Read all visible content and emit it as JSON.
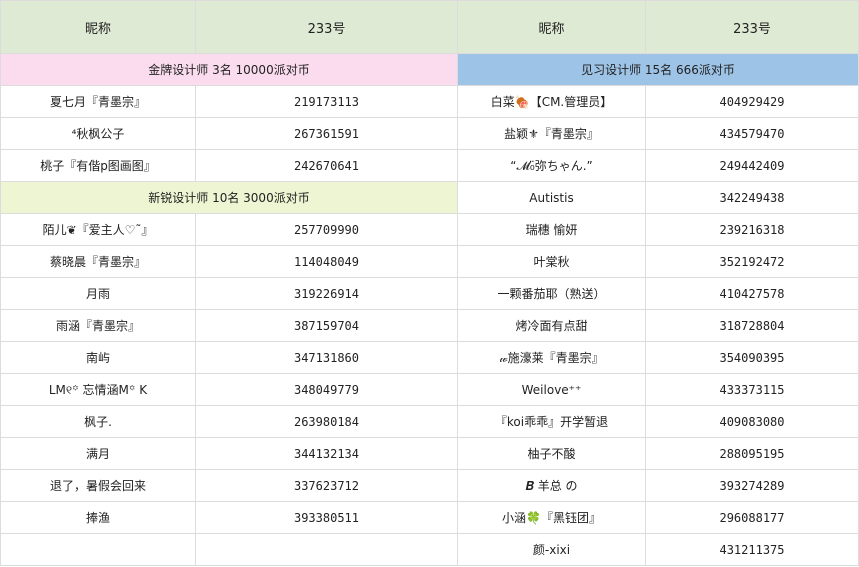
{
  "header": {
    "left_name": "昵称",
    "left_id": "233号",
    "right_name": "昵称",
    "right_id": "233号"
  },
  "sections": {
    "gold": "金牌设计师 3名 10000派对币",
    "intern": "见习设计师 15名 666派对币",
    "newbie": "新锐设计师 10名 3000派对币"
  },
  "left": {
    "gold": [
      {
        "name": "夏七月『青墨宗』",
        "id": "219173113"
      },
      {
        "name": "⁴秋枫公子",
        "id": "267361591"
      },
      {
        "name": "桃子『有偕p图画图』",
        "id": "242670641"
      }
    ],
    "newbie": [
      {
        "name": "陌儿❦『爱主人♡˜』",
        "id": "257709990"
      },
      {
        "name": "蔡晓晨『青墨宗』",
        "id": "114048049"
      },
      {
        "name": "月雨",
        "id": "319226914"
      },
      {
        "name": "雨涵『青墨宗』",
        "id": "387159704"
      },
      {
        "name": "南屿",
        "id": "347131860"
      },
      {
        "name": "LM୧꙳ 忘情涵M꙳ K",
        "id": "348049779"
      },
      {
        "name": "枫子.",
        "id": "263980184"
      },
      {
        "name": "满月",
        "id": "344132134"
      },
      {
        "name": "退了，暑假会回来",
        "id": "337623712"
      },
      {
        "name": "捧渔",
        "id": "393380511"
      },
      {
        "name": "",
        "id": ""
      }
    ]
  },
  "right": [
    {
      "name": "白菜🍖【CM.管理员】",
      "id": "404929429"
    },
    {
      "name": "盐颖⚜『青墨宗』",
      "id": "434579470"
    },
    {
      "name": "“𝓜₀̈弥ちゃん.”",
      "id": "249442409"
    },
    {
      "name": "Autistis",
      "id": "342249438"
    },
    {
      "name": "瑞穗 愉妍",
      "id": "239216318"
    },
    {
      "name": "叶棠秋",
      "id": "352192472"
    },
    {
      "name": "一颗番茄耶（熟送）",
      "id": "410427578"
    },
    {
      "name": "烤冷面有点甜",
      "id": "318728804"
    },
    {
      "name": "𝓌施濠莱『青墨宗』",
      "id": "354090395"
    },
    {
      "name": "Weilove⁺⁺",
      "id": "433373115"
    },
    {
      "name": "『koi乖乖』开学暂退",
      "id": "409083080"
    },
    {
      "name": "柚子不酸",
      "id": "288095195"
    },
    {
      "name": "𝑩 羊总 の",
      "id": "393274289"
    },
    {
      "name": "小涵🍀『黑钰团』",
      "id": "296088177"
    },
    {
      "name": "颜-xixi",
      "id": "431211375"
    }
  ]
}
